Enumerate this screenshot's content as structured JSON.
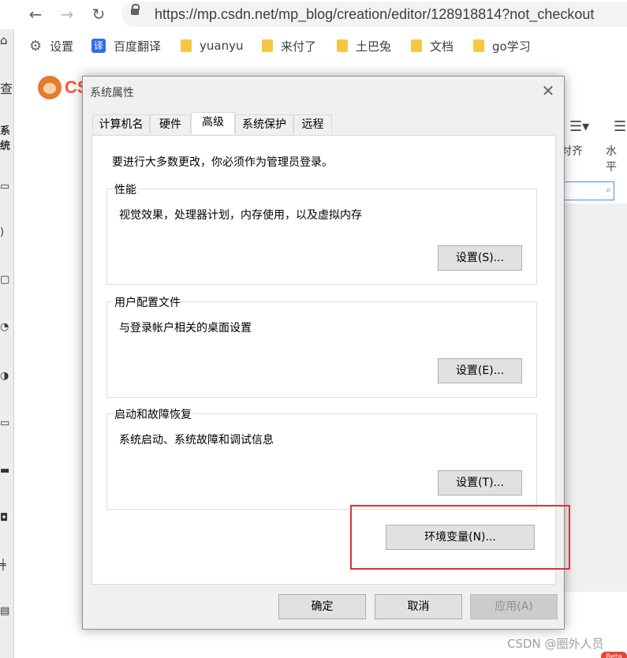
{
  "browser": {
    "back_icon": "←",
    "forward_icon": "→",
    "reload_icon": "↻",
    "url": "https://mp.csdn.net/mp_blog/creation/editor/128918814?not_checkout",
    "bookmarks": [
      {
        "label": "设置",
        "icon": "gear-icon"
      },
      {
        "label": "百度翻译",
        "icon": "translate-icon",
        "glyph": "译"
      },
      {
        "label": "yuanyu",
        "icon": "folder-icon"
      },
      {
        "label": "来付了",
        "icon": "folder-icon"
      },
      {
        "label": "土巴兔",
        "icon": "folder-icon"
      },
      {
        "label": "文档",
        "icon": "folder-icon"
      },
      {
        "label": "go学习",
        "icon": "folder-icon"
      }
    ]
  },
  "page_behind": {
    "logo_text": "CS",
    "left_strip_char": "查",
    "left_strip_char2": "系统",
    "toolbar_align_label": "对齐",
    "toolbar_horizontal_label": "水平",
    "watermark": "CSDN @圈外人员",
    "beta_badge": "Beta"
  },
  "dialog": {
    "title": "系统属性",
    "close_icon": "✕",
    "tabs": [
      {
        "label": "计算机名",
        "active": false
      },
      {
        "label": "硬件",
        "active": false
      },
      {
        "label": "高级",
        "active": true
      },
      {
        "label": "系统保护",
        "active": false
      },
      {
        "label": "远程",
        "active": false
      }
    ],
    "admin_note": "要进行大多数更改，你必须作为管理员登录。",
    "groups": {
      "performance": {
        "title": "性能",
        "description": "视觉效果，处理器计划，内存使用，以及虚拟内存",
        "button": "设置(S)..."
      },
      "user_profiles": {
        "title": "用户配置文件",
        "description": "与登录帐户相关的桌面设置",
        "button": "设置(E)..."
      },
      "startup_recovery": {
        "title": "启动和故障恢复",
        "description": "系统启动、系统故障和调试信息",
        "button": "设置(T)..."
      }
    },
    "env_button": "环境变量(N)...",
    "ok_button": "确定",
    "cancel_button": "取消",
    "apply_button": "应用(A)"
  },
  "colors": {
    "highlight_border": "#e03131",
    "csdn_red": "#fc5531",
    "dialog_bg": "#f0f0f0"
  }
}
